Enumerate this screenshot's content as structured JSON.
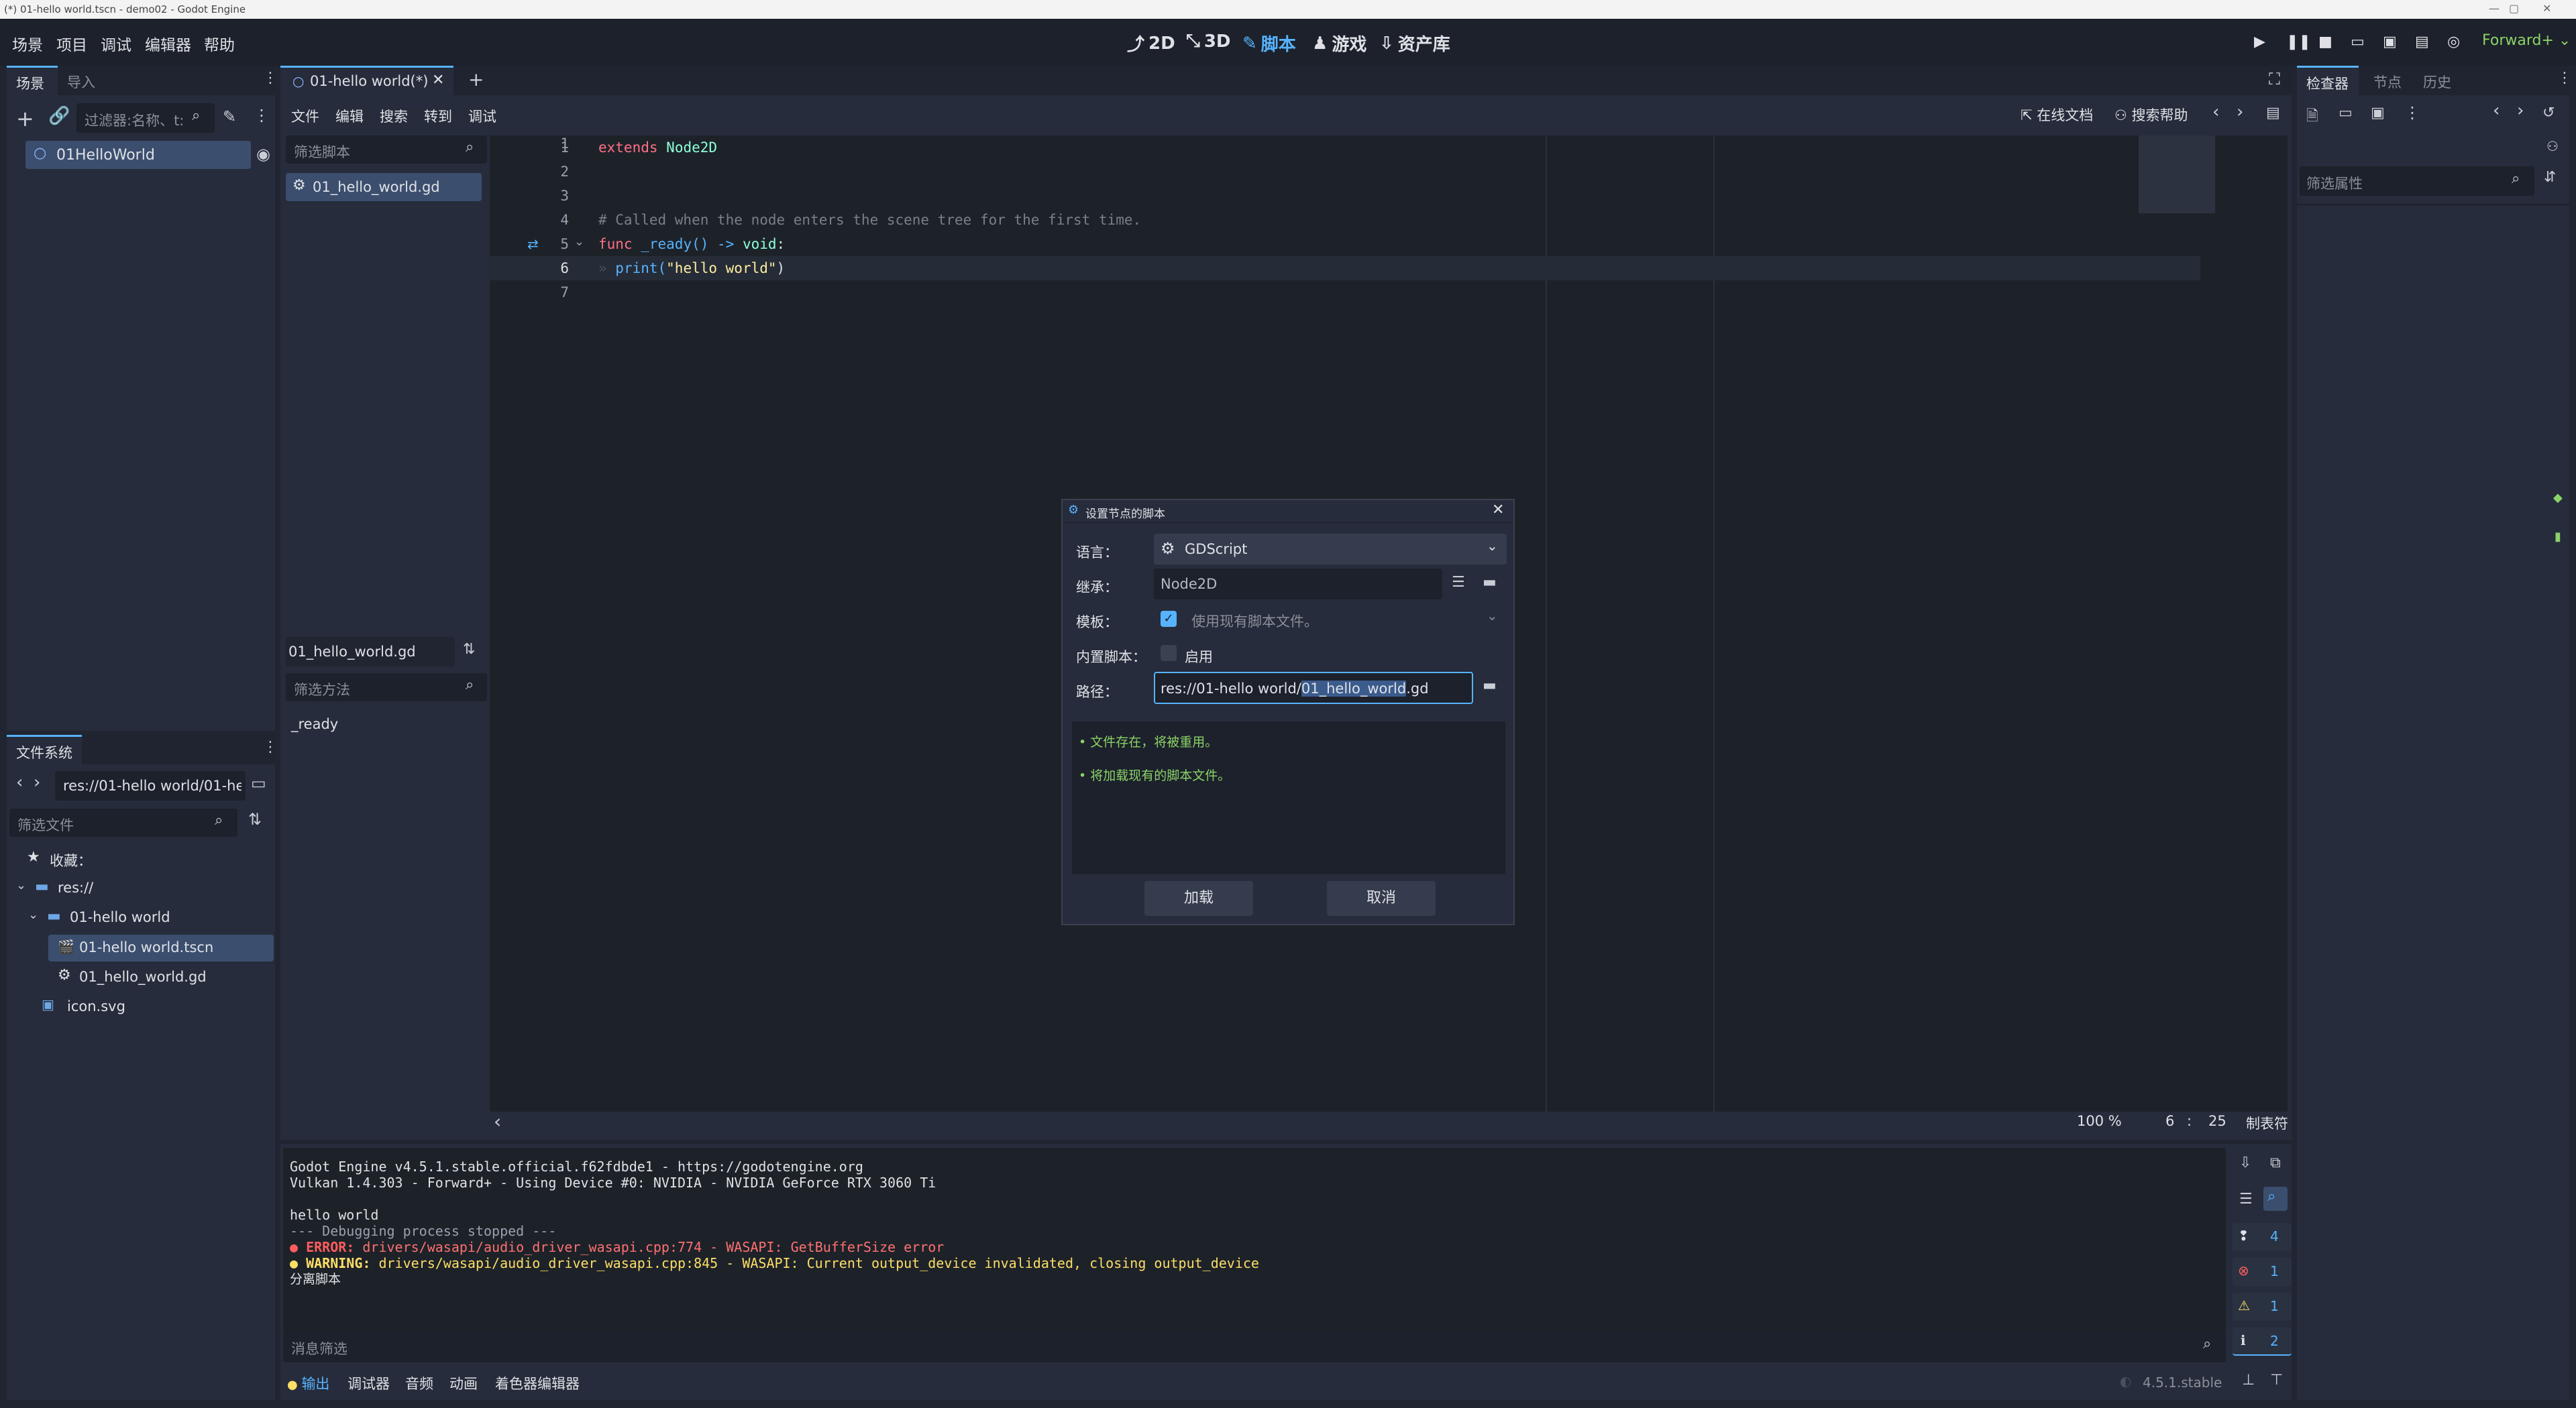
{
  "window": {
    "title": "(*) 01-hello world.tscn - demo02 - Godot Engine"
  },
  "menu": [
    "场景",
    "项目",
    "调试",
    "编辑器",
    "帮助"
  ],
  "workspaces": [
    {
      "label": "2D",
      "icon": "2d-icon"
    },
    {
      "label": "3D",
      "icon": "3d-icon"
    },
    {
      "label": "脚本",
      "icon": "script-icon",
      "active": true
    },
    {
      "label": "游戏",
      "icon": "game-icon"
    },
    {
      "label": "资产库",
      "icon": "assetlib-icon"
    }
  ],
  "renderer": "Forward+",
  "scene_dock": {
    "tabs": [
      "场景",
      "导入"
    ],
    "filter_placeholder": "过滤器:名称、t:",
    "root_node": "01HelloWorld"
  },
  "filesystem": {
    "title": "文件系统",
    "path": "res://01-hello world/01-he",
    "filter_placeholder": "筛选文件",
    "items": [
      {
        "label": "收藏：",
        "icon": "star-icon"
      },
      {
        "label": "res://",
        "icon": "folder-icon"
      },
      {
        "label": "01-hello world",
        "icon": "folder-icon"
      },
      {
        "label": "01-hello world.tscn",
        "icon": "scene-icon",
        "selected": true
      },
      {
        "label": "01_hello_world.gd",
        "icon": "gear-icon"
      },
      {
        "label": "icon.svg",
        "icon": "image-icon"
      }
    ]
  },
  "script_tabs": {
    "current": "01-hello world(*)"
  },
  "script_menu": [
    "文件",
    "编辑",
    "搜索",
    "转到",
    "调试"
  ],
  "script_toolbar": {
    "online_docs": "在线文档",
    "search_help": "搜索帮助"
  },
  "script_list": {
    "filter_placeholder": "筛选脚本",
    "items": [
      "01_hello_world.gd"
    ],
    "current_file": "01_hello_world.gd",
    "method_filter_placeholder": "筛选方法",
    "methods": [
      "_ready"
    ]
  },
  "code": {
    "line_numbers": [
      "1",
      "2",
      "3",
      "4",
      "5",
      "6",
      "7"
    ],
    "line1_kw": "extends",
    "line1_type": "Node2D",
    "line4_comment": "# Called when the node enters the scene tree for the first time.",
    "line5_func": "func",
    "line5_name": "_ready() ->",
    "line5_type": "void",
    "line5_colon": ":",
    "line6_call": "print(",
    "line6_str": "\"hello world\"",
    "line6_end": ")"
  },
  "editor_status": {
    "zoom": "100 %",
    "line": "6",
    "col": "25",
    "indent": "制表符"
  },
  "output": {
    "lines": [
      "Godot Engine v4.5.1.stable.official.f62fdbde1 - https://godotengine.org",
      "Vulkan 1.4.303 - Forward+ - Using Device #0: NVIDIA - NVIDIA GeForce RTX 3060 Ti",
      "",
      "hello world",
      "--- Debugging process stopped ---"
    ],
    "error_label": "ERROR:",
    "error_text": "drivers/wasapi/audio_driver_wasapi.cpp:774 - WASAPI: GetBufferSize error",
    "warning_label": "WARNING:",
    "warning_text": "drivers/wasapi/audio_driver_wasapi.cpp:845 - WASAPI: Current output_device invalidated, closing output_device",
    "detach": "分离脚本",
    "filter_placeholder": "消息筛选",
    "counts": {
      "messages": "4",
      "errors": "1",
      "warnings": "1",
      "info": "2"
    }
  },
  "bottom_tabs": [
    "输出",
    "调试器",
    "音频",
    "动画",
    "着色器编辑器"
  ],
  "version": "4.5.1.stable",
  "inspector": {
    "tabs": [
      "检查器",
      "节点",
      "历史"
    ],
    "filter_placeholder": "筛选属性"
  },
  "dialog": {
    "title": "设置节点的脚本",
    "language_label": "语言：",
    "language_value": "GDScript",
    "inherits_label": "继承：",
    "inherits_value": "Node2D",
    "template_label": "模板：",
    "template_value": "使用现有脚本文件。",
    "builtin_label": "内置脚本：",
    "builtin_toggle": "启用",
    "path_label": "路径：",
    "path_prefix": "res://01-hello world/",
    "path_selected": "01_hello_world",
    "path_suffix": ".gd",
    "messages": [
      "文件存在，将被重用。",
      "将加载现有的脚本文件。"
    ],
    "load_button": "加载",
    "cancel_button": "取消"
  },
  "colors": {
    "accent": "#57b3ff",
    "keyword": "#ff7085",
    "type": "#8effda",
    "string": "#ffeda1",
    "comment": "#7b7f87",
    "function": "#57b3ff",
    "error": "#ff5d5d",
    "warning": "#ffde66",
    "ok": "#8bd366"
  }
}
